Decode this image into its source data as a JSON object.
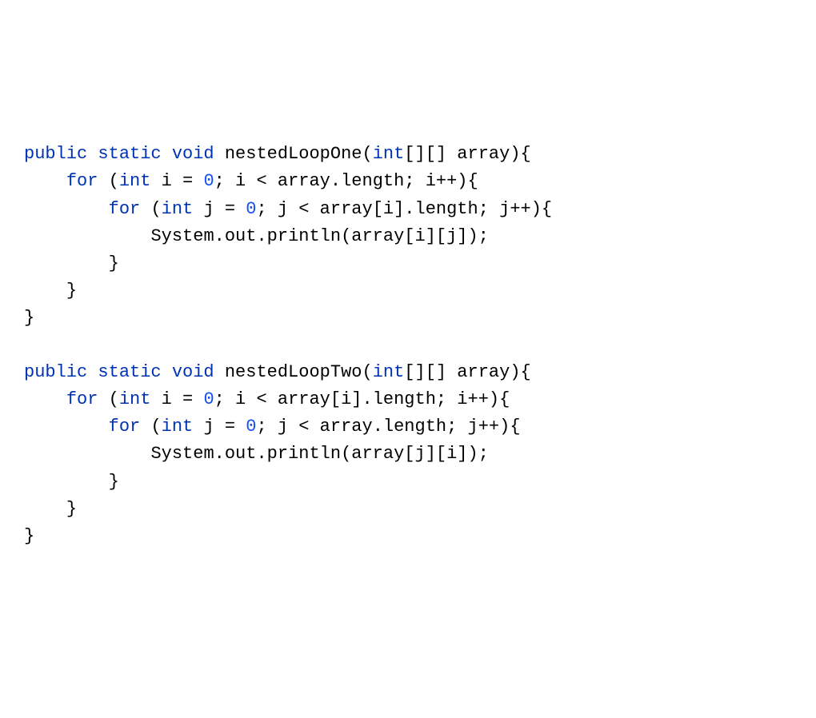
{
  "code": {
    "method1": {
      "sig_p1": "public static void ",
      "sig_name": "nestedLoopOne",
      "sig_p2": "(",
      "sig_type": "int",
      "sig_p3": "[][] array){",
      "l2a": "for ",
      "l2b": "(",
      "l2c": "int ",
      "l2d": "i = ",
      "l2e": "0",
      "l2f": "; i < array.length; i++){",
      "l3a": "for ",
      "l3b": "(",
      "l3c": "int ",
      "l3d": "j = ",
      "l3e": "0",
      "l3f": "; j < array[i].length; j++){",
      "l4": "System.out.println(array[i][j]);",
      "l5": "}",
      "l6": "}",
      "l7": "}"
    },
    "method2": {
      "sig_p1": "public static void ",
      "sig_name": "nestedLoopTwo",
      "sig_p2": "(",
      "sig_type": "int",
      "sig_p3": "[][] array){",
      "l2a": "for ",
      "l2b": "(",
      "l2c": "int ",
      "l2d": "i = ",
      "l2e": "0",
      "l2f": "; i < array[i].length; i++){",
      "l3a": "for ",
      "l3b": "(",
      "l3c": "int ",
      "l3d": "j = ",
      "l3e": "0",
      "l3f": "; j < array.length; j++){",
      "l4": "System.out.println(array[j][i]);",
      "l5": "}",
      "l6": "}",
      "l7": "}"
    }
  }
}
